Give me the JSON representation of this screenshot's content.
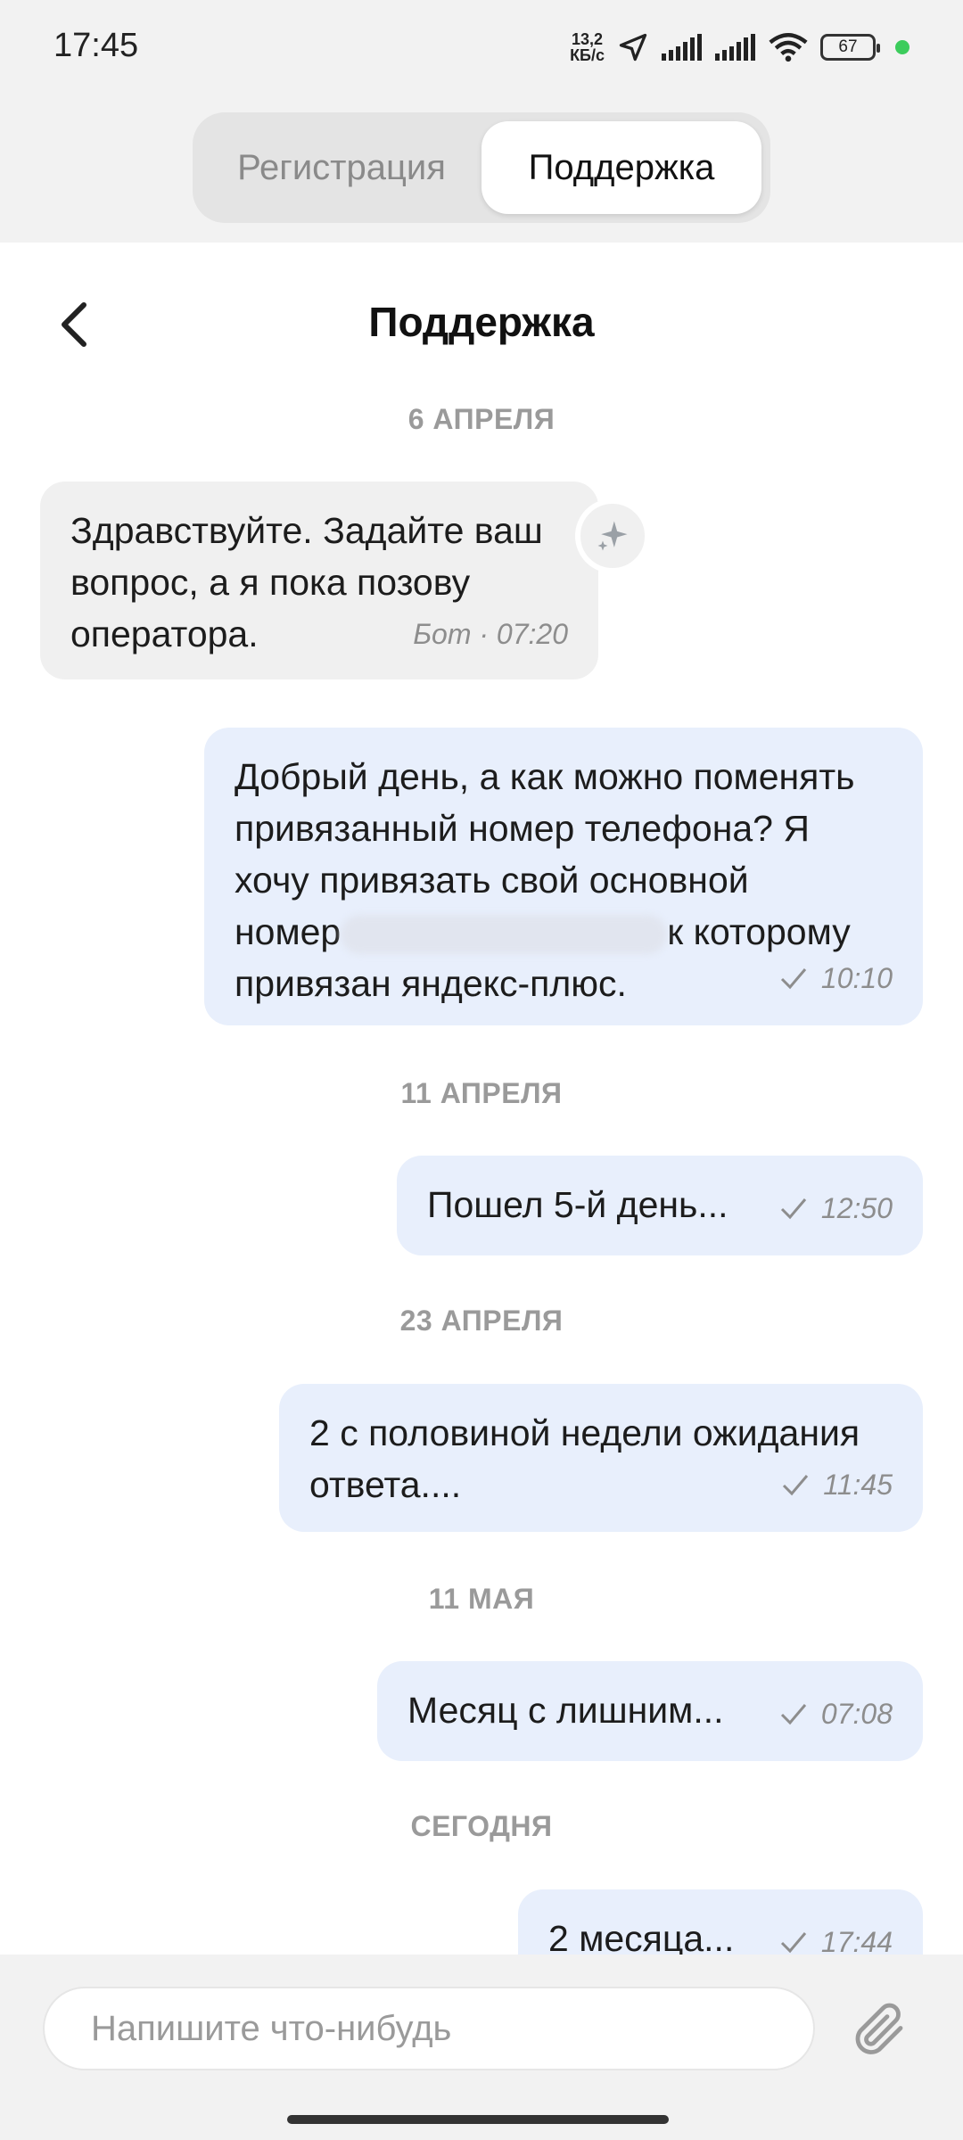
{
  "status_bar": {
    "time": "17:45",
    "net_speed_value": "13,2",
    "net_speed_unit": "КБ/с",
    "battery": "67",
    "icons": [
      "navigation-icon",
      "signal-icon",
      "signal-icon",
      "wifi-icon",
      "battery-icon"
    ]
  },
  "segments": {
    "registration": "Регистрация",
    "support": "Поддержка",
    "active": "support"
  },
  "header": {
    "title": "Поддержка"
  },
  "chat": {
    "date_1": "6 АПРЕЛЯ",
    "msg_1": {
      "line1": "Здравствуйте. Задайте ваш",
      "line2": "вопрос, а я пока позову",
      "line3": "оператора.",
      "meta": "Бот · 07:20"
    },
    "msg_2": {
      "line1": "Добрый день, а как можно поменять",
      "line2": "привязанный номер телефона? Я",
      "line3": "хочу привязать свой основной",
      "line4a": "номер",
      "line4b": "к которому",
      "line5": "привязан яндекс-плюс.",
      "time": "10:10"
    },
    "date_2": "11 АПРЕЛЯ",
    "msg_3": {
      "text": "Пошел 5-й день...",
      "time": "12:50"
    },
    "date_3": "23 АПРЕЛЯ",
    "msg_4": {
      "line1": "2 с половиной недели ожидания",
      "line2": "ответа....",
      "time": "11:45"
    },
    "date_4": "11 МАЯ",
    "msg_5": {
      "text": "Месяц с лишним...",
      "time": "07:08"
    },
    "date_5": "СЕГОДНЯ",
    "msg_6": {
      "text": "2 месяца...",
      "time": "17:44"
    }
  },
  "input": {
    "placeholder": "Напишите что-нибудь"
  },
  "colors": {
    "outgoing_bubble": "#e8effc",
    "incoming_bubble": "#f0f0f0",
    "background": "#ffffff",
    "bar_background": "#f2f2f2"
  }
}
